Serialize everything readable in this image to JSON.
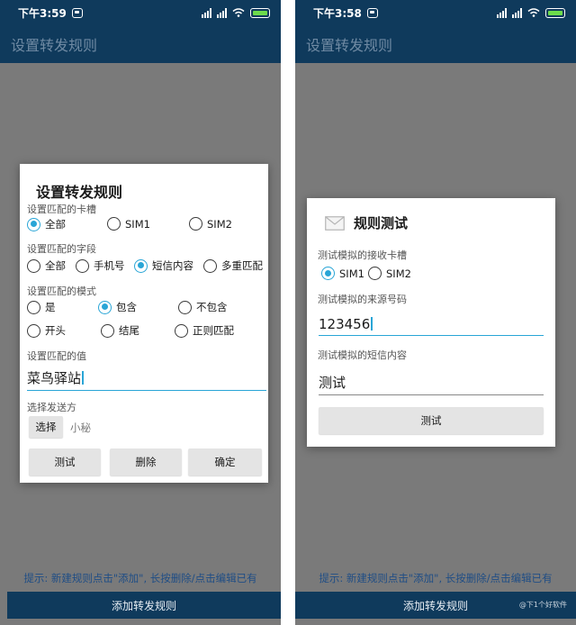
{
  "screens": {
    "left": {
      "status_time": "下午3:59",
      "app_title": "设置转发规则",
      "dialog": {
        "title": "设置转发规则",
        "sim_label": "设置匹配的卡槽",
        "sim_options": [
          "全部",
          "SIM1",
          "SIM2"
        ],
        "field_label": "设置匹配的字段",
        "field_options": [
          "全部",
          "手机号",
          "短信内容",
          "多重匹配"
        ],
        "mode_label": "设置匹配的模式",
        "mode_options": [
          "是",
          "包含",
          "不包含",
          "开头",
          "结尾",
          "正则匹配"
        ],
        "value_label": "设置匹配的值",
        "value": "菜鸟驿站",
        "sender_label": "选择发送方",
        "select_button": "选择",
        "selected_sender": "小秘",
        "test_button": "测试",
        "delete_button": "删除",
        "confirm_button": "确定"
      },
      "hint": "提示: 新建规则点击\"添加\", 长按删除/点击编辑已有",
      "add_button": "添加转发规则"
    },
    "right": {
      "status_time": "下午3:58",
      "app_title": "设置转发规则",
      "dialog": {
        "title": "规则测试",
        "sim_label": "测试模拟的接收卡槽",
        "sim_options": [
          "SIM1",
          "SIM2"
        ],
        "phone_label": "测试模拟的来源号码",
        "phone_value": "123456",
        "content_label": "测试模拟的短信内容",
        "content_value": "测试",
        "test_button": "测试"
      },
      "hint": "提示: 新建规则点击\"添加\", 长按删除/点击编辑已有",
      "add_button": "添加转发规则",
      "watermark": "@下1个好软件"
    }
  },
  "selected": {
    "left_sim": "全部",
    "left_field": "短信内容",
    "left_mode": "包含",
    "right_sim": "SIM1"
  },
  "colors": {
    "app_bar": "#0f3a5c",
    "accent": "#29a5d6",
    "screen_dim": "#7a7a7a",
    "hint_text": "#1f4d85"
  },
  "icons": {
    "status": [
      "notification-icon",
      "signal-icon",
      "signal-icon",
      "wifi-icon",
      "battery-charging-icon"
    ],
    "dialog_right": "envelope-icon"
  }
}
